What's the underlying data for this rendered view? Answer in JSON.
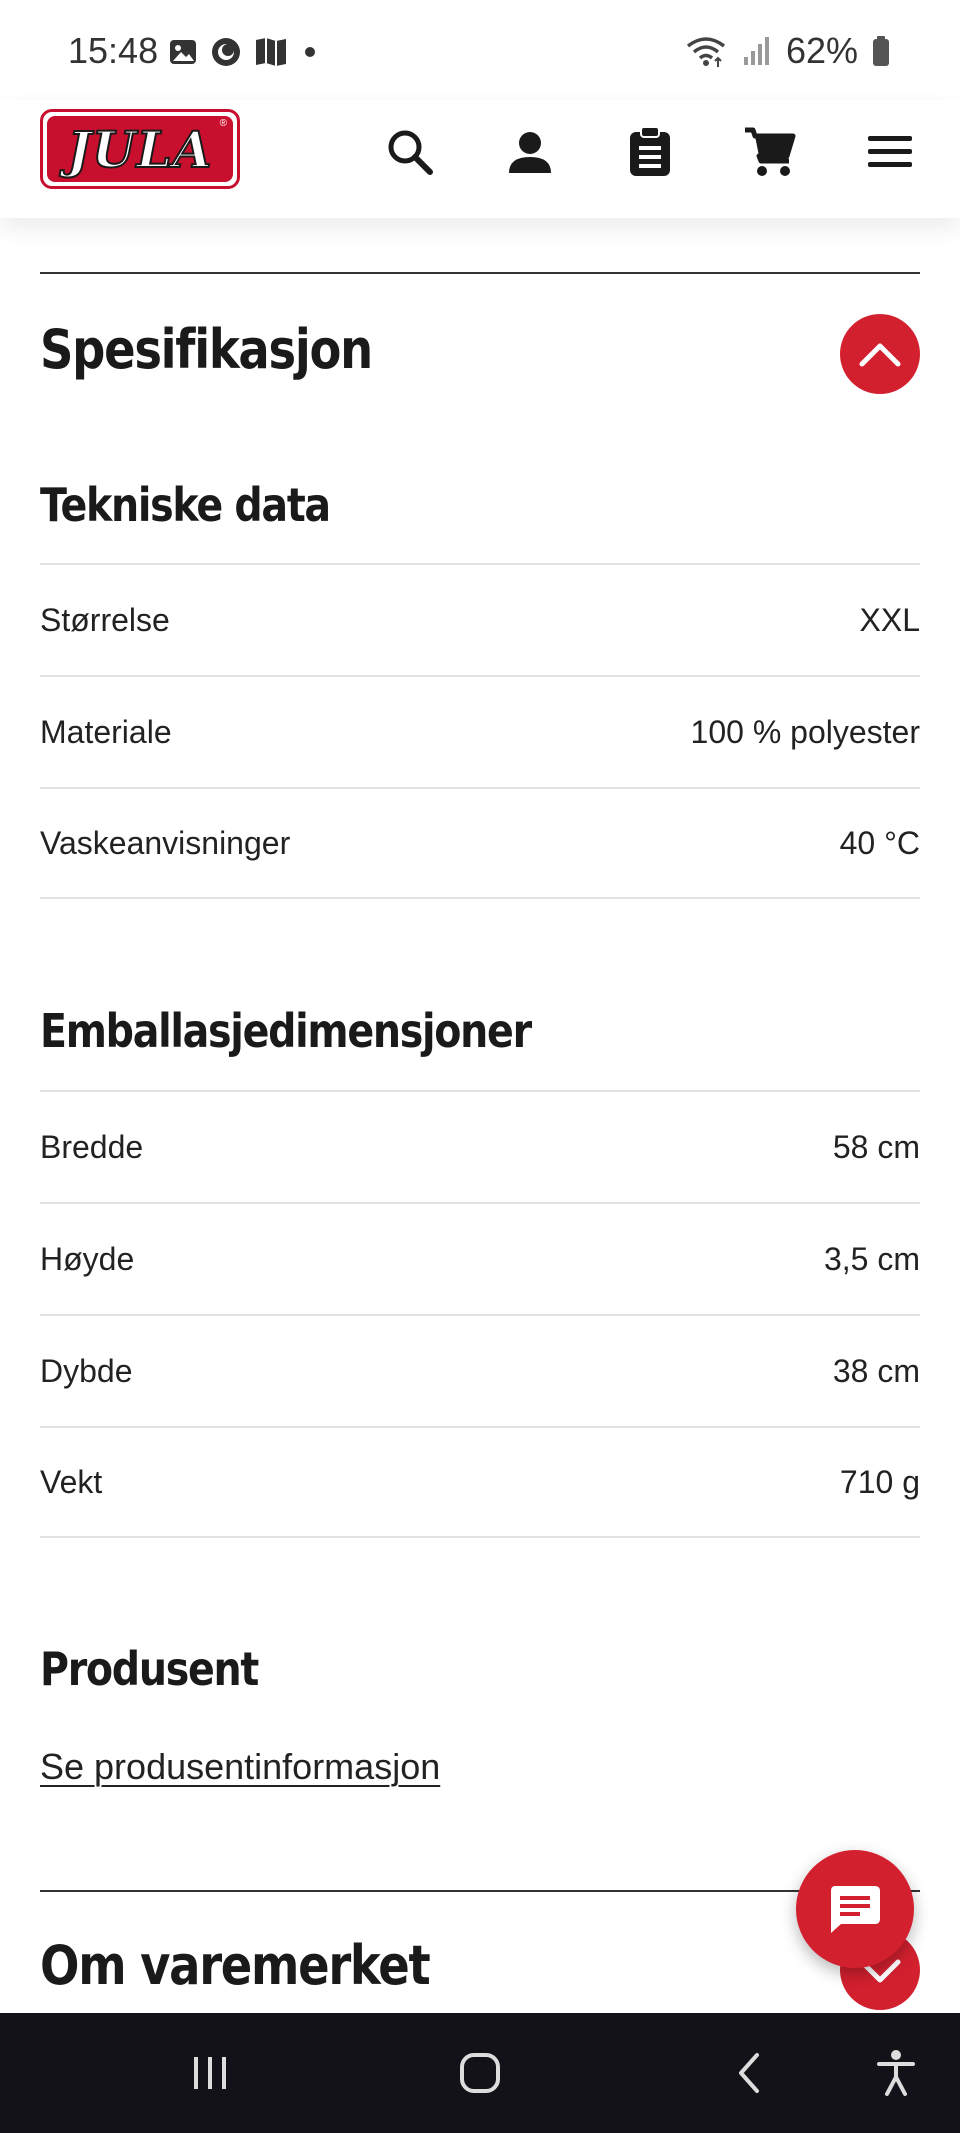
{
  "status_bar": {
    "time": "15:48",
    "battery": "62%",
    "left_icons": [
      "gallery-icon",
      "circle-app-icon",
      "map-icon",
      "dot-icon"
    ],
    "right_icons": [
      "wifi-icon",
      "signal-icon",
      "battery-icon"
    ]
  },
  "header": {
    "logo_text": "JULA",
    "logo_mark": "®",
    "icons": [
      "search-icon",
      "account-icon",
      "clipboard-icon",
      "cart-icon",
      "menu-icon"
    ]
  },
  "colors": {
    "brand_red": "#d3202f",
    "nav_bar": "#131218"
  },
  "specification": {
    "title": "Spesifikasjon",
    "technical": {
      "title": "Tekniske data",
      "rows": [
        {
          "label": "Størrelse",
          "value": "XXL"
        },
        {
          "label": "Materiale",
          "value": "100 % polyester"
        },
        {
          "label": "Vaskeanvisninger",
          "value": "40 °C"
        }
      ]
    },
    "packaging": {
      "title": "Emballasjedimensjoner",
      "rows": [
        {
          "label": "Bredde",
          "value": "58 cm"
        },
        {
          "label": "Høyde",
          "value": "3,5 cm"
        },
        {
          "label": "Dybde",
          "value": "38 cm"
        },
        {
          "label": "Vekt",
          "value": "710 g"
        }
      ]
    },
    "manufacturer": {
      "title": "Produsent",
      "link": "Se produsentinformasjon"
    }
  },
  "brand_section": {
    "title": "Om varemerket"
  },
  "nav_bar": {
    "buttons": [
      "recent-apps-icon",
      "home-icon",
      "back-icon",
      "accessibility-icon"
    ]
  }
}
